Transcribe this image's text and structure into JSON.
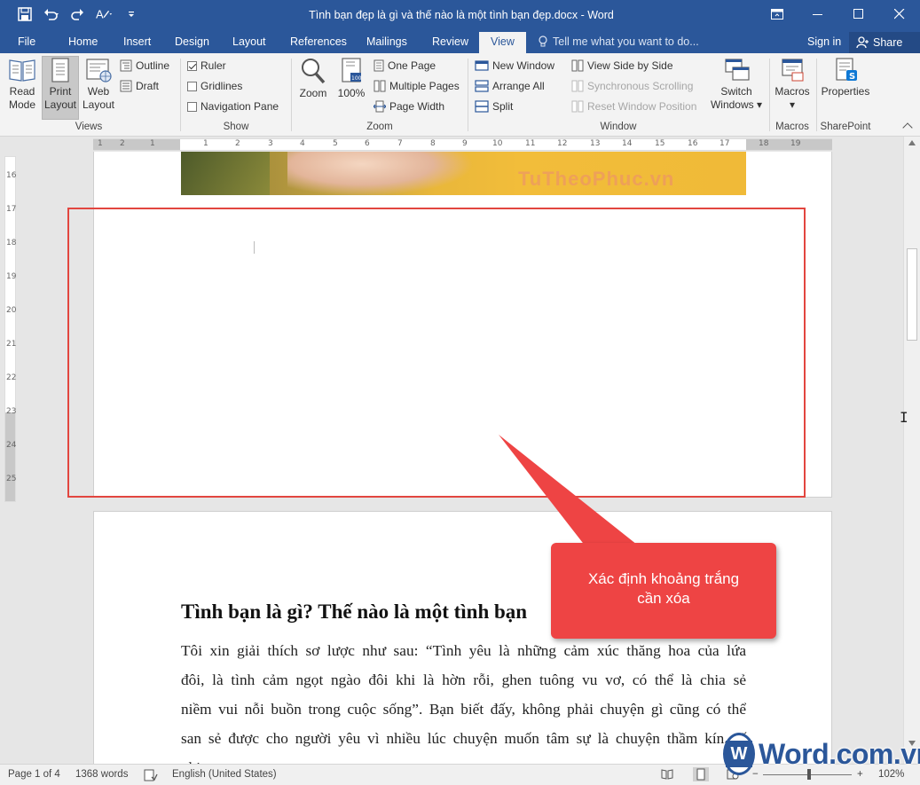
{
  "window": {
    "title": "Tình bạn đẹp là gì và thế nào là một tình bạn đẹp.docx - Word",
    "icons": [
      "save-icon",
      "undo-icon",
      "redo-icon",
      "format-painter-icon",
      "customize-qat-icon",
      "ribbon-display-icon",
      "minimize-icon",
      "maximize-icon",
      "close-icon"
    ]
  },
  "tabs": [
    "File",
    "Home",
    "Insert",
    "Design",
    "Layout",
    "References",
    "Mailings",
    "Review",
    "View"
  ],
  "active_tab": "View",
  "tell_me": "Tell me what you want to do...",
  "sign_in": "Sign in",
  "share": "Share",
  "ribbon": {
    "views": {
      "label": "Views",
      "read_mode": "Read Mode",
      "read_mode_l1": "Read",
      "read_mode_l2": "Mode",
      "print_layout_l1": "Print",
      "print_layout_l2": "Layout",
      "web_layout_l1": "Web",
      "web_layout_l2": "Layout",
      "outline": "Outline",
      "draft": "Draft"
    },
    "show": {
      "label": "Show",
      "ruler": "Ruler",
      "ruler_checked": true,
      "gridlines": "Gridlines",
      "gridlines_checked": false,
      "navigation_pane": "Navigation Pane",
      "navigation_pane_checked": false
    },
    "zoom": {
      "label": "Zoom",
      "zoom": "Zoom",
      "hundred": "100%",
      "one_page": "One Page",
      "multiple_pages": "Multiple Pages",
      "page_width": "Page Width"
    },
    "window": {
      "label": "Window",
      "new_window": "New Window",
      "arrange_all": "Arrange All",
      "split": "Split",
      "view_side_by_side": "View Side by Side",
      "synchronous_scrolling": "Synchronous Scrolling",
      "reset_window_position": "Reset Window Position",
      "switch_windows_l1": "Switch",
      "switch_windows_l2": "Windows"
    },
    "macros": {
      "label": "Macros",
      "macros": "Macros"
    },
    "sharepoint": {
      "label": "SharePoint",
      "properties": "Properties"
    }
  },
  "rulers": {
    "horizontal_ticks": [
      "1",
      "2",
      "1",
      "1",
      "2",
      "3",
      "4",
      "5",
      "6",
      "7",
      "8",
      "9",
      "10",
      "11",
      "12",
      "13",
      "14",
      "15",
      "16",
      "17",
      "18",
      "19"
    ],
    "vertical_ticks": [
      "16",
      "17",
      "18",
      "19",
      "20",
      "21",
      "22",
      "23",
      "24",
      "25"
    ]
  },
  "photo_watermark": "TuTheoPhuc.vn",
  "document": {
    "heading": "Tình bạn là gì? Thế nào là một tình bạn",
    "lines": [
      "Tôi xin giải thích sơ lược như sau: “Tình yêu là những cảm xúc thăng hoa của lứa",
      "đôi, là tình cảm ngọt ngào đôi khi là hờn rỗi, ghen tuông vu vơ, có thể là chia sẻ",
      "niềm vui nỗi buồn trong cuộc sống”. Bạn biết đấy, không phải chuyện gì cũng có thể",
      "san sẻ được cho người yêu vì nhiều lúc chuyện muốn tâm sự là chuyện thầm kín, tế",
      "nhị..."
    ]
  },
  "annotation": {
    "callout_text": "Xác định khoảng trắng cần xóa",
    "color": "#ee4444",
    "box_color": "#e2463f"
  },
  "status": {
    "page": "Page 1 of 4",
    "words": "1368 words",
    "language": "English (United States)",
    "zoom_minus": "−",
    "zoom_plus": "+",
    "zoom_level": "102%"
  },
  "logo": {
    "badge": "W",
    "text": "Word.com.vn"
  },
  "colors": {
    "accent": "#2b579a",
    "ribbon_bg": "#f3f3f3",
    "doc_bg": "#e6e6e6"
  }
}
